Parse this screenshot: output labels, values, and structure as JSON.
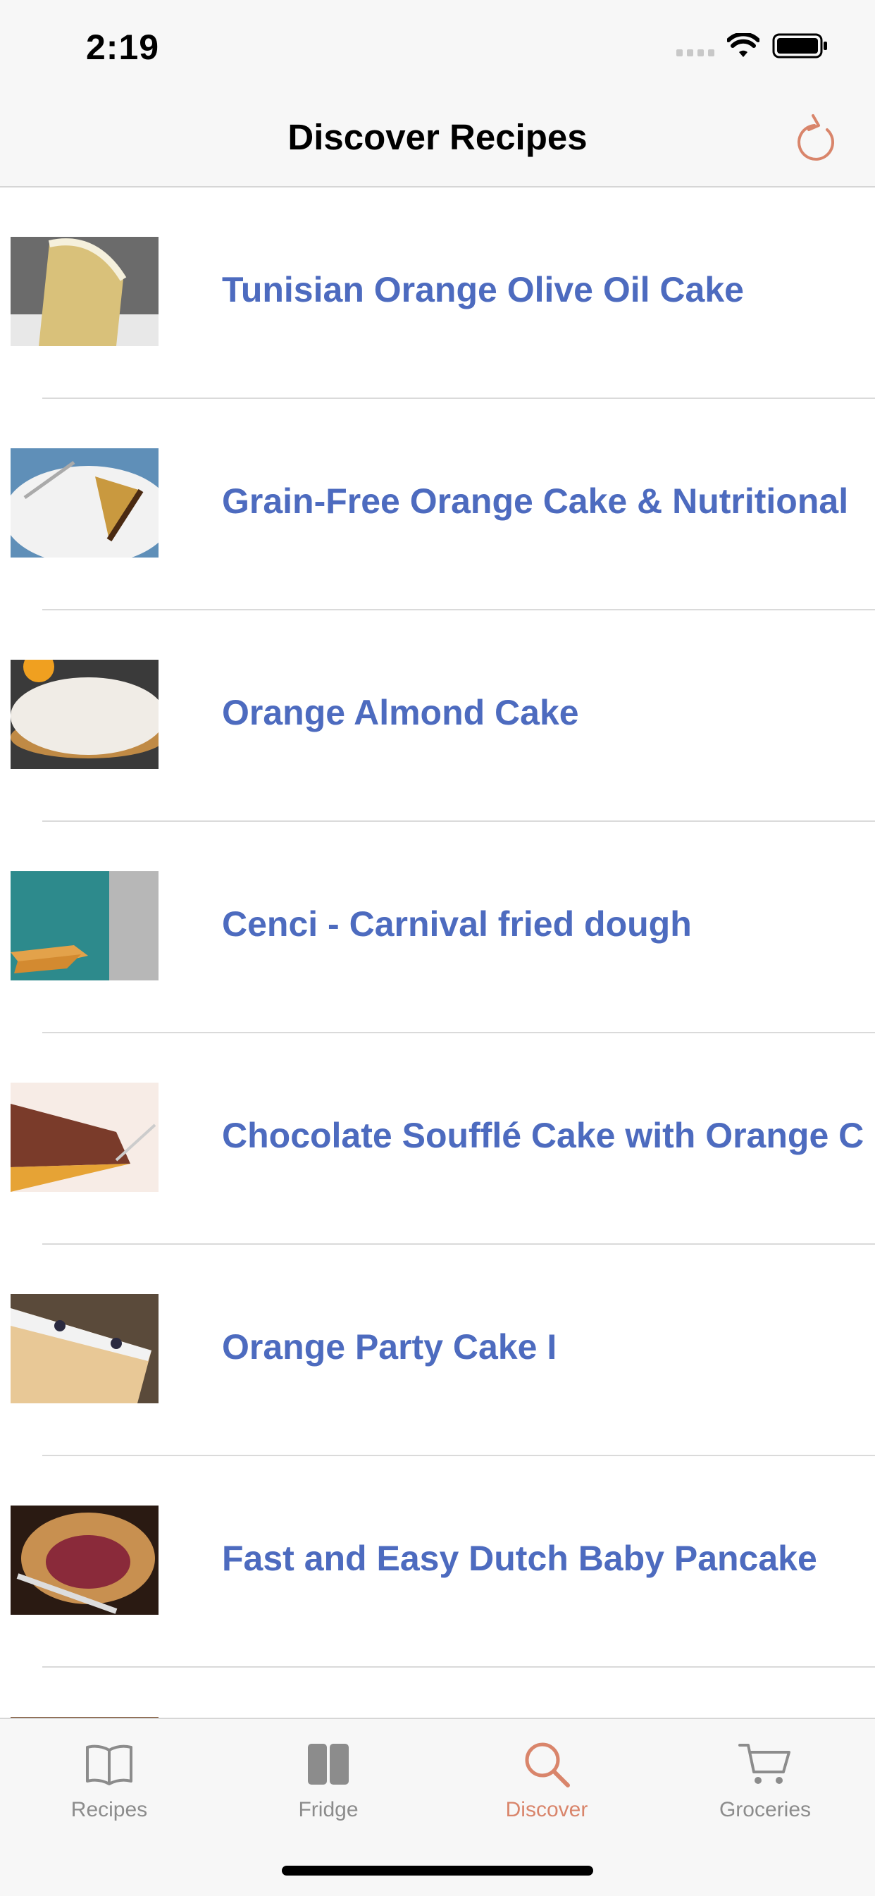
{
  "status_bar": {
    "time": "2:19",
    "icons": [
      "signal-icon",
      "wifi-icon",
      "battery-icon"
    ]
  },
  "header": {
    "title": "Discover Recipes",
    "refresh_icon": "refresh-icon"
  },
  "recipes": [
    {
      "title": "Tunisian Orange Olive Oil Cake"
    },
    {
      "title": "Grain-Free Orange Cake & Nutritional"
    },
    {
      "title": "Orange Almond Cake"
    },
    {
      "title": "Cenci - Carnival fried dough"
    },
    {
      "title": "Chocolate Soufflé Cake with Orange C"
    },
    {
      "title": "Orange Party Cake I"
    },
    {
      "title": "Fast and Easy Dutch Baby Pancake"
    }
  ],
  "tabs": [
    {
      "label": "Recipes",
      "icon": "book-icon",
      "active": false
    },
    {
      "label": "Fridge",
      "icon": "fridge-icon",
      "active": false
    },
    {
      "label": "Discover",
      "icon": "search-icon",
      "active": true
    },
    {
      "label": "Groceries",
      "icon": "cart-icon",
      "active": false
    }
  ],
  "colors": {
    "link": "#4d6bbf",
    "accent": "#d9856b",
    "inactive": "#8c8c8c"
  }
}
